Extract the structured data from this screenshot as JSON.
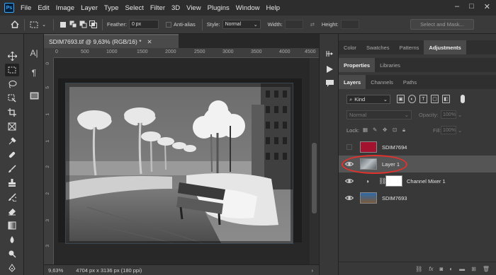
{
  "menubar": {
    "logo": "Ps",
    "items": [
      "File",
      "Edit",
      "Image",
      "Layer",
      "Type",
      "Select",
      "Filter",
      "3D",
      "View",
      "Plugins",
      "Window",
      "Help"
    ]
  },
  "options": {
    "feather_label": "Feather:",
    "feather_value": "0 px",
    "antialias": "Anti-alias",
    "style_label": "Style:",
    "style_value": "Normal",
    "width_label": "Width:",
    "height_label": "Height:",
    "mask_button": "Select and Mask..."
  },
  "document": {
    "tab_title": "SDIM7693.tif @ 9,63% (RGB/16) *",
    "ruler_h": [
      "0",
      "500",
      "1000",
      "1500",
      "2000",
      "2500",
      "3000",
      "3500",
      "4000",
      "4500"
    ],
    "ruler_v": [
      "0",
      "5",
      "1",
      "1",
      "2",
      "2",
      "3",
      "3"
    ],
    "zoom": "9,63%",
    "doc_info": "4704 px x 3136 px (180 ppi)"
  },
  "panels": {
    "top_tabs": [
      "Color",
      "Swatches",
      "Patterns",
      "Adjustments"
    ],
    "mid_tabs": [
      "Properties",
      "Libraries"
    ],
    "layer_tabs": [
      "Layers",
      "Channels",
      "Paths"
    ],
    "kind_label": "Kind",
    "blend_mode": "Normal",
    "opacity_label": "Opacity:",
    "opacity_value": "100%",
    "lock_label": "Lock:",
    "fill_label": "Fill:",
    "fill_value": "100%"
  },
  "layers": [
    {
      "name": "SDIM7694",
      "visible": false,
      "selected": false,
      "thumb_color": "#a3122e"
    },
    {
      "name": "Layer 1",
      "visible": true,
      "selected": true,
      "thumb_color": "#9aa3a8"
    },
    {
      "name": "Channel Mixer 1",
      "visible": true,
      "selected": false,
      "thumb_color": "#ffffff"
    },
    {
      "name": "SDIM7693",
      "visible": true,
      "selected": false,
      "thumb_color": "#4a78a8"
    }
  ],
  "colors": {
    "annotation_oval": "#e0322d",
    "accent": "#31a8ff"
  }
}
